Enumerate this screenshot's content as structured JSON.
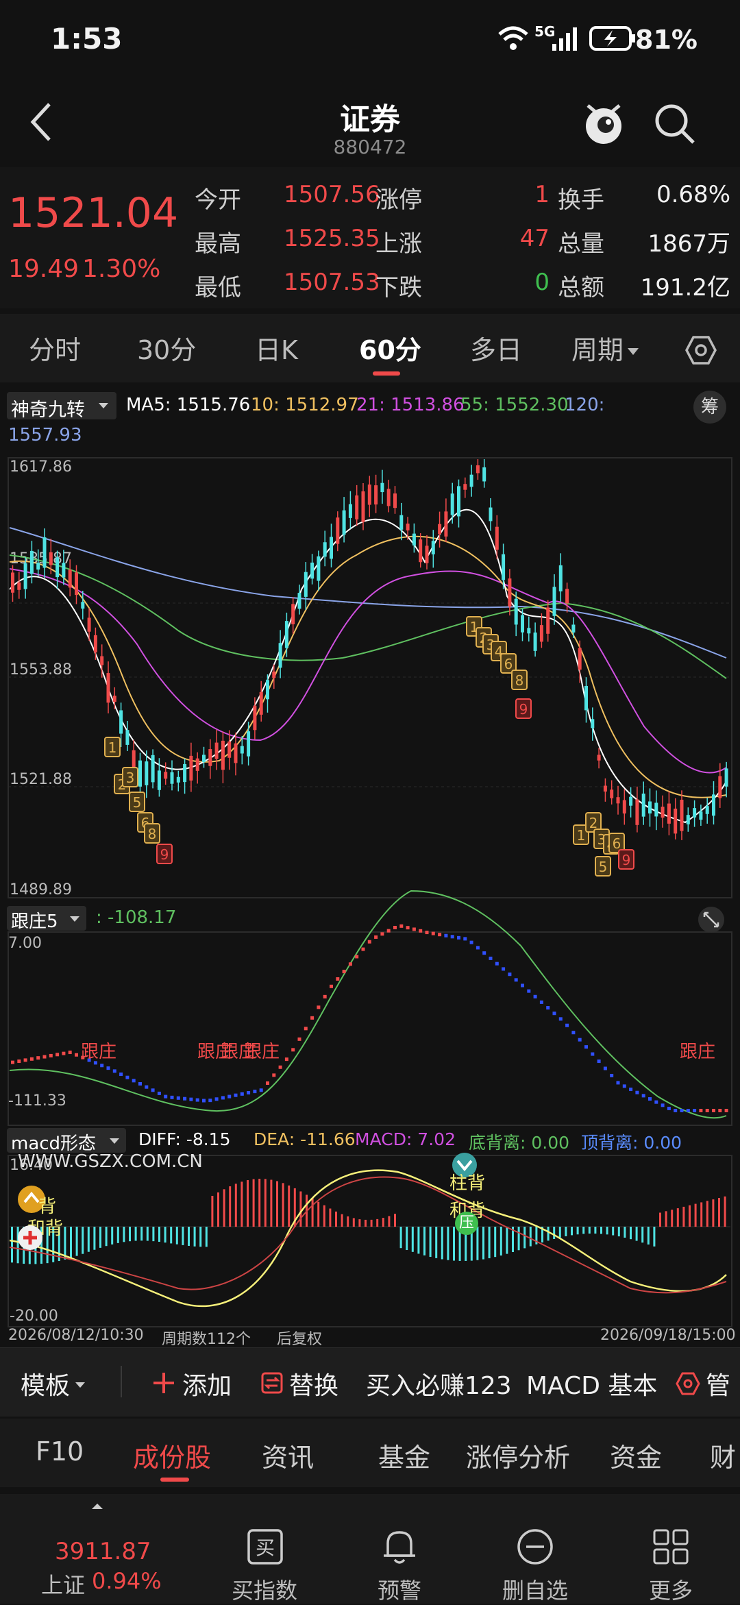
{
  "status_bar": {
    "time": "1:53",
    "network": "5G",
    "battery": "81%"
  },
  "header": {
    "title": "证券",
    "code": "880472"
  },
  "quote": {
    "price": "1521.04",
    "change": "19.49",
    "change_pct": "1.30%",
    "rows": [
      {
        "l1": "今开",
        "v1": "1507.56",
        "l2": "涨停",
        "v2": "1",
        "l3": "换手",
        "v3": "0.68%"
      },
      {
        "l1": "最高",
        "v1": "1525.35",
        "l2": "上涨",
        "v2": "47",
        "l3": "总量",
        "v3": "1867万"
      },
      {
        "l1": "最低",
        "v1": "1507.53",
        "l2": "下跌",
        "v2": "0",
        "l3": "总额",
        "v3": "191.2亿"
      }
    ]
  },
  "period_tabs": [
    "分时",
    "30分",
    "日K",
    "60分",
    "多日",
    "周期"
  ],
  "main": {
    "indicator": "神奇九转",
    "ma5": "MA5: 1515.76",
    "ma10": "10: 1512.97",
    "ma21": "21: 1513.86",
    "ma55": "55: 1552.30",
    "ma120": "120:",
    "ma120_val": "1557.93",
    "chip_btn": "筹",
    "y_labels": [
      "1617.86",
      "1585.87",
      "1553.88",
      "1521.88",
      "1489.89"
    ]
  },
  "sub1": {
    "name": "跟庄5",
    "value": ": -108.17",
    "y_top": "7.00",
    "y_bottom": "-111.33",
    "tags": [
      "跟庄",
      "跟庄",
      "跟庄",
      "跟庄",
      "跟庄"
    ]
  },
  "sub2": {
    "name": "macd形态",
    "diff": "DIFF: -8.15",
    "dea": "DEA: -11.66",
    "macd": "MACD: 7.02",
    "bottom_div": "底背离: 0.00",
    "top_div": "顶背离: 0.00",
    "watermark": "WWW.GSZX.COM.CN",
    "y_top": "16.40",
    "y_bottom": "-20.00",
    "tags": [
      "柱背",
      "和背",
      "压",
      "背",
      "和背"
    ]
  },
  "x_axis": {
    "start": "2026/08/12/10:30",
    "periods": "周期数112个",
    "adjust": "后复权",
    "end": "2026/09/18/15:00"
  },
  "toolbar": {
    "template": "模板",
    "add": "添加",
    "replace": "替换",
    "promo": "买入必赚123",
    "macd_basic": "MACD 基本",
    "more": "管"
  },
  "sub_tabs": [
    "F10",
    "成份股",
    "资讯",
    "基金",
    "涨停分析",
    "资金",
    "财"
  ],
  "bottom_nav": {
    "index_value": "3911.87",
    "index_name": "上证",
    "index_pct": "0.94%",
    "items": [
      "买指数",
      "预警",
      "删自选",
      "更多"
    ]
  },
  "colors": {
    "up": "#f04a4a",
    "down": "#4fe3e3",
    "ma5": "#ffffff",
    "ma10": "#f0c060",
    "ma21": "#d050e0",
    "ma55": "#5fc060",
    "ma120": "#8aa4e8"
  }
}
